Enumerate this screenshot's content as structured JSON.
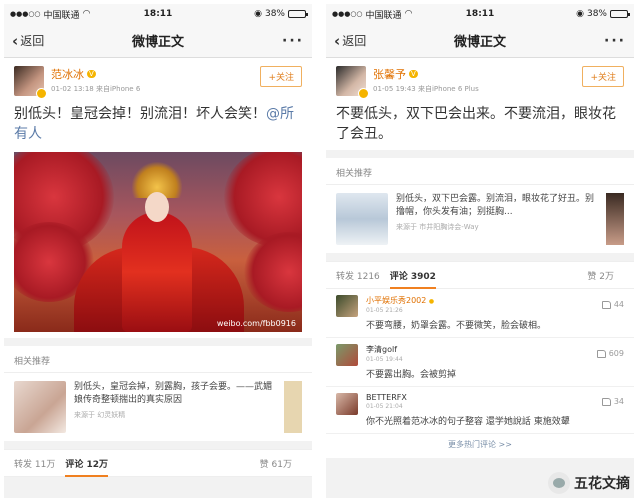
{
  "status": {
    "carrier": "中国联通",
    "time": "18:11",
    "battery": "38%",
    "battery_level": 0.38
  },
  "nav": {
    "back": "返回",
    "title": "微博正文",
    "more": "···"
  },
  "left": {
    "author": "范冰冰",
    "meta": "01-02 13:18 来自iPhone 6",
    "follow": "+关注",
    "text": "别低头！皇冠会掉！别流泪！坏人会笑！",
    "mention": "@所有人",
    "image_watermark": "weibo.com/fbb0916",
    "related_label": "相关推荐",
    "rec_text": "别低头，皇冠会掉，别露胸，孩子会要。——武媚娘传奇整顿揣出的真实原因",
    "rec_source": "来源于 幻灵妖精",
    "tabs": {
      "repost": "转发 11万",
      "comments": "评论 12万",
      "likes": "赞 61万"
    }
  },
  "right": {
    "author": "张馨予",
    "meta": "01-05 19:43 来自iPhone 6 Plus",
    "follow": "+关注",
    "text": "不要低头，双下巴会出来。不要流泪，眼妆花了会丑。",
    "related_label": "相关推荐",
    "rec_text": "别低头，双下巴会露。别流泪，眼妆花了好丑。别撸帽，你头发有油；别挺胸...",
    "rec_source": "来源于 市井阳胸诗会-Way",
    "tabs": {
      "repost": "转发 1216",
      "comments": "评论 3902",
      "likes": "赞 2万"
    },
    "comments": [
      {
        "name": "小平娱乐秀2002",
        "time": "01-05 21:26",
        "likes": "44",
        "text": "不要弯腰，奶罩会露。不要微笑，脸会破相。"
      },
      {
        "name": "李清golf",
        "time": "01-05 19:44",
        "likes": "609",
        "text": "不要露出胸。会被剪掉"
      },
      {
        "name": "BETTERFX",
        "time": "01-05 21:04",
        "likes": "34",
        "text": "你不光照着范冰冰的句子整容 還学她說話 東施效顰"
      }
    ],
    "more_comments": "更多热门评论 >>"
  },
  "brand": {
    "name": "五花文摘"
  }
}
